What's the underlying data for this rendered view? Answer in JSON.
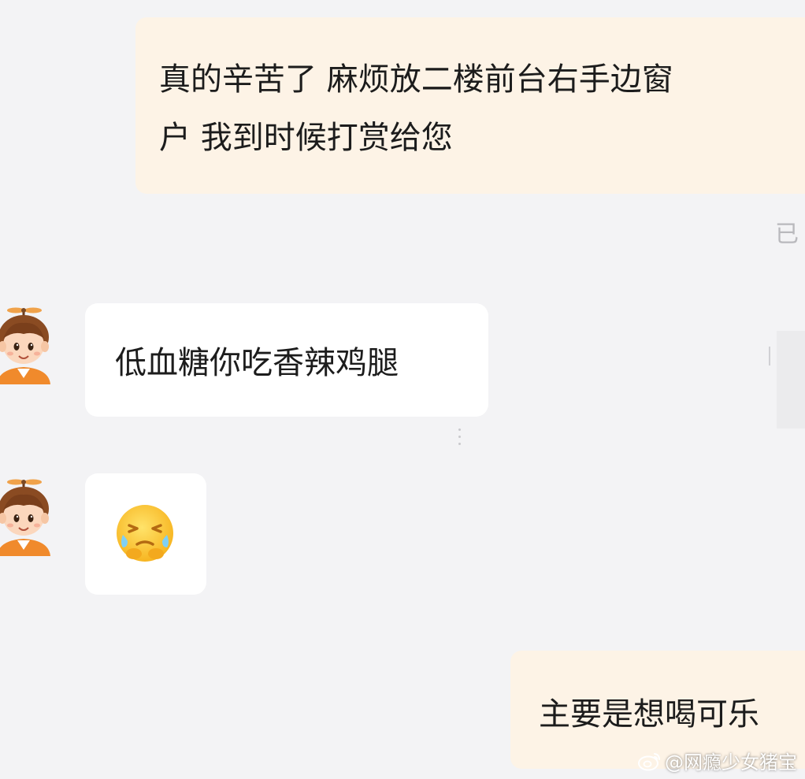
{
  "messages": {
    "outgoing_1": {
      "line_1": "真的辛苦了 麻烦放二楼前台右手边窗",
      "line_2": "户 我到时候打赏给您",
      "status": "已"
    },
    "incoming_1": {
      "text": "低血糖你吃香辣鸡腿"
    },
    "incoming_2": {
      "emoji": "crying-laughing-emoji"
    },
    "outgoing_2": {
      "text": "主要是想喝可乐"
    }
  },
  "avatar": {
    "icon": "cartoon-boy-propeller-hat-avatar"
  },
  "watermark": {
    "icon": "weibo-icon",
    "text": "@网瘾少女猪宝"
  },
  "colors": {
    "background": "#f3f3f5",
    "outgoing_bubble": "#fdf3e6",
    "incoming_bubble": "#ffffff",
    "avatar_orange": "#f08a2c"
  }
}
